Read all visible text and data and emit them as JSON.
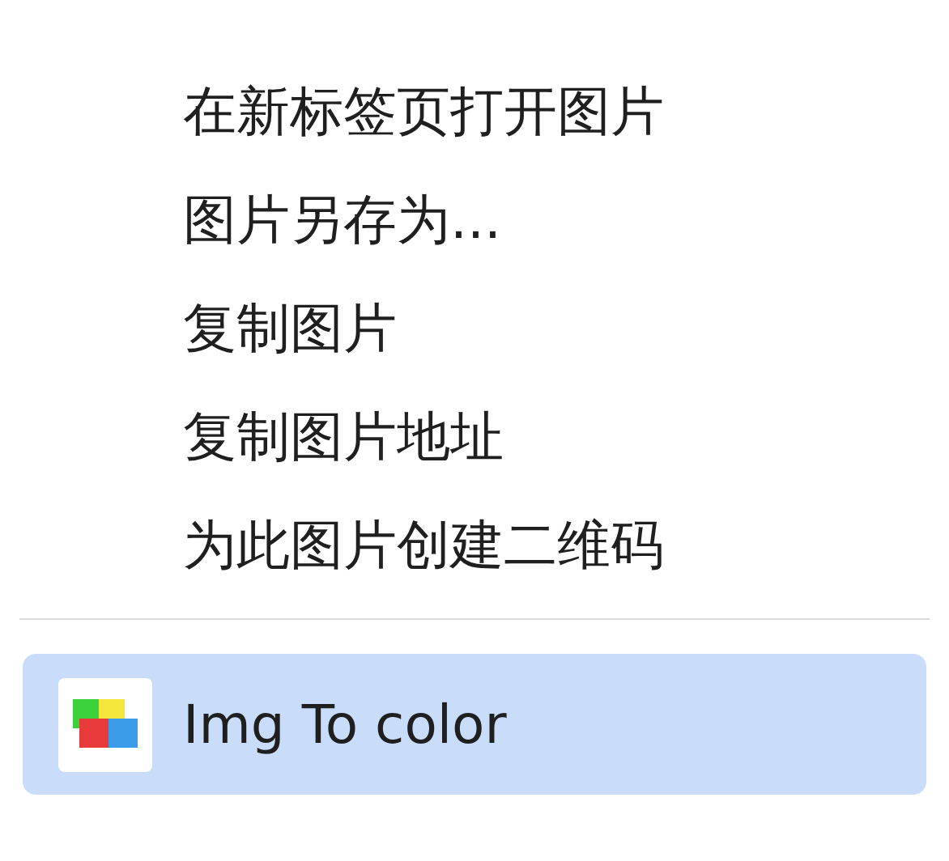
{
  "menu": {
    "items": [
      {
        "kind": "plain",
        "label": "在新标签页打开图片",
        "selected": false
      },
      {
        "kind": "plain",
        "label": "图片另存为...",
        "selected": false
      },
      {
        "kind": "plain",
        "label": "复制图片",
        "selected": false
      },
      {
        "kind": "plain",
        "label": "复制图片地址",
        "selected": false
      },
      {
        "kind": "plain",
        "label": "为此图片创建二维码",
        "selected": false
      },
      {
        "kind": "separator"
      },
      {
        "kind": "extension",
        "label": "Img To color",
        "selected": true
      }
    ]
  }
}
